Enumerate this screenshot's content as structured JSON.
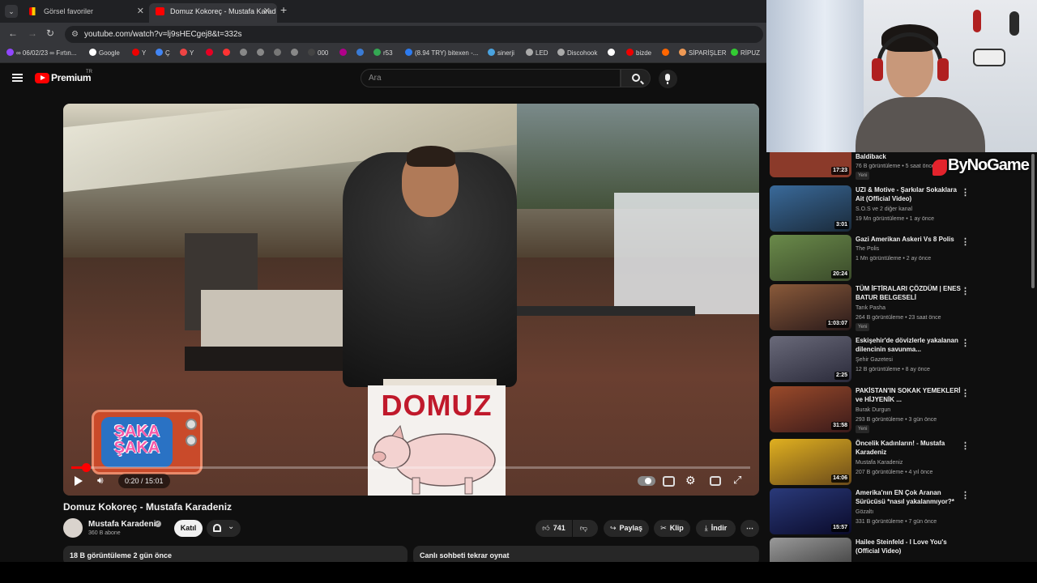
{
  "browser": {
    "tabs": [
      {
        "title": "Görsel favoriler",
        "active": false
      },
      {
        "title": "Domuz Kokoreç - Mustafa Karad",
        "active": true
      }
    ],
    "url": "youtube.com/watch?v=lj9sHECgej8&t=332s",
    "bookmarks": [
      "∞ 06/02/23 ∞ Fırtın...",
      "Google",
      "Y",
      "Ç",
      "Y",
      "",
      "",
      "",
      "",
      "",
      "",
      "000",
      "",
      "",
      "",
      "r53",
      "(8.94 TRY) bitexen -...",
      "sinerji",
      "LED",
      "Discohook",
      "",
      "bizde",
      "",
      "SİPARİŞLER",
      "RİPUZ"
    ]
  },
  "youtube": {
    "brand": "Premium",
    "region": "TR",
    "search_placeholder": "Ara"
  },
  "video": {
    "title": "Domuz Kokoreç - Mustafa Karadeniz",
    "current_time": "0:20",
    "duration": "15:01",
    "time_display": "0:20 / 15:01",
    "progress_fraction": 0.022,
    "sign_text": "DOMUZ",
    "overlay_text": [
      "ŞAKA",
      "ŞAKA"
    ],
    "channel": "Mustafa Karadeniz",
    "subscribers": "360 B abone",
    "join_label": "Katıl",
    "likes": "741",
    "share_label": "Paylaş",
    "clip_label": "Klip",
    "download_label": "İndir",
    "views_date": "18 B görüntüleme  2 gün önce",
    "chat_replay": "Canlı sohbeti tekrar oynat"
  },
  "overlay": {
    "streamer_brand": "ByNoGame"
  },
  "sidebar": {
    "items": [
      {
        "title": "Baldiback",
        "channel": "",
        "meta": "76 B görüntüleme • 5 saat önce",
        "duration": "17:23",
        "badge": "Yeni",
        "thumb": "#8b3a2a"
      },
      {
        "title": "UZI & Motive - Şarkılar Sokaklara Ait (Official Video)",
        "channel": "S.O.S ve 2 diğer kanal",
        "meta": "19 Mn görüntüleme • 1 ay önce",
        "duration": "3:01",
        "badge": "",
        "thumb": "#2b4a6a"
      },
      {
        "title": "Gazi Amerikan Askeri Vs 8 Polis",
        "channel": "The Polis",
        "meta": "1 Mn görüntüleme • 2 ay önce",
        "duration": "20:24",
        "badge": "",
        "thumb": "#4f6f3a"
      },
      {
        "title": "TÜM İFTİRALARI ÇÖZDÜM | ENES BATUR BELGESELİ",
        "channel": "Tarık Pasha",
        "meta": "264 B görüntüleme • 23 saat önce",
        "duration": "1:03:07",
        "badge": "Yeni",
        "thumb": "#5a3a2a"
      },
      {
        "title": "Eskişehir'de dövizlerle yakalanan dilencinin savunma...",
        "channel": "Şehir Gazetesi",
        "meta": "12 B görüntüleme • 8 ay önce",
        "duration": "2:25",
        "badge": "",
        "thumb": "#3a3a4a"
      },
      {
        "title": "PAKİSTAN'IN SOKAK YEMEKLERİ ve HİJYENİK ...",
        "channel": "Burak Durgun",
        "meta": "293 B görüntüleme • 3 gün önce",
        "duration": "31:58",
        "badge": "Yeni",
        "thumb": "#7a3a2a"
      },
      {
        "title": "Öncelik Kadınların! - Mustafa Karadeniz",
        "channel": "Mustafa Karadeniz",
        "meta": "207 B görüntüleme • 4 yıl önce",
        "duration": "14:06",
        "badge": "",
        "thumb": "#c99a1a"
      },
      {
        "title": "Amerika'nın EN Çok Aranan Sürücüsü *nasıl yakalanmıyor?*",
        "channel": "Gözaltı",
        "meta": "331 B görüntüleme • 7 gün önce",
        "duration": "15:57",
        "badge": "",
        "thumb": "#1a2a5a"
      },
      {
        "title": "Hailee Steinfeld - I Love You's (Official Video)",
        "channel": "",
        "meta": "",
        "duration": "",
        "badge": "",
        "thumb": "#6a6a6a"
      }
    ]
  },
  "colors": {
    "accent": "#ff0000",
    "background": "#0f0f0f",
    "chip": "#272727"
  }
}
